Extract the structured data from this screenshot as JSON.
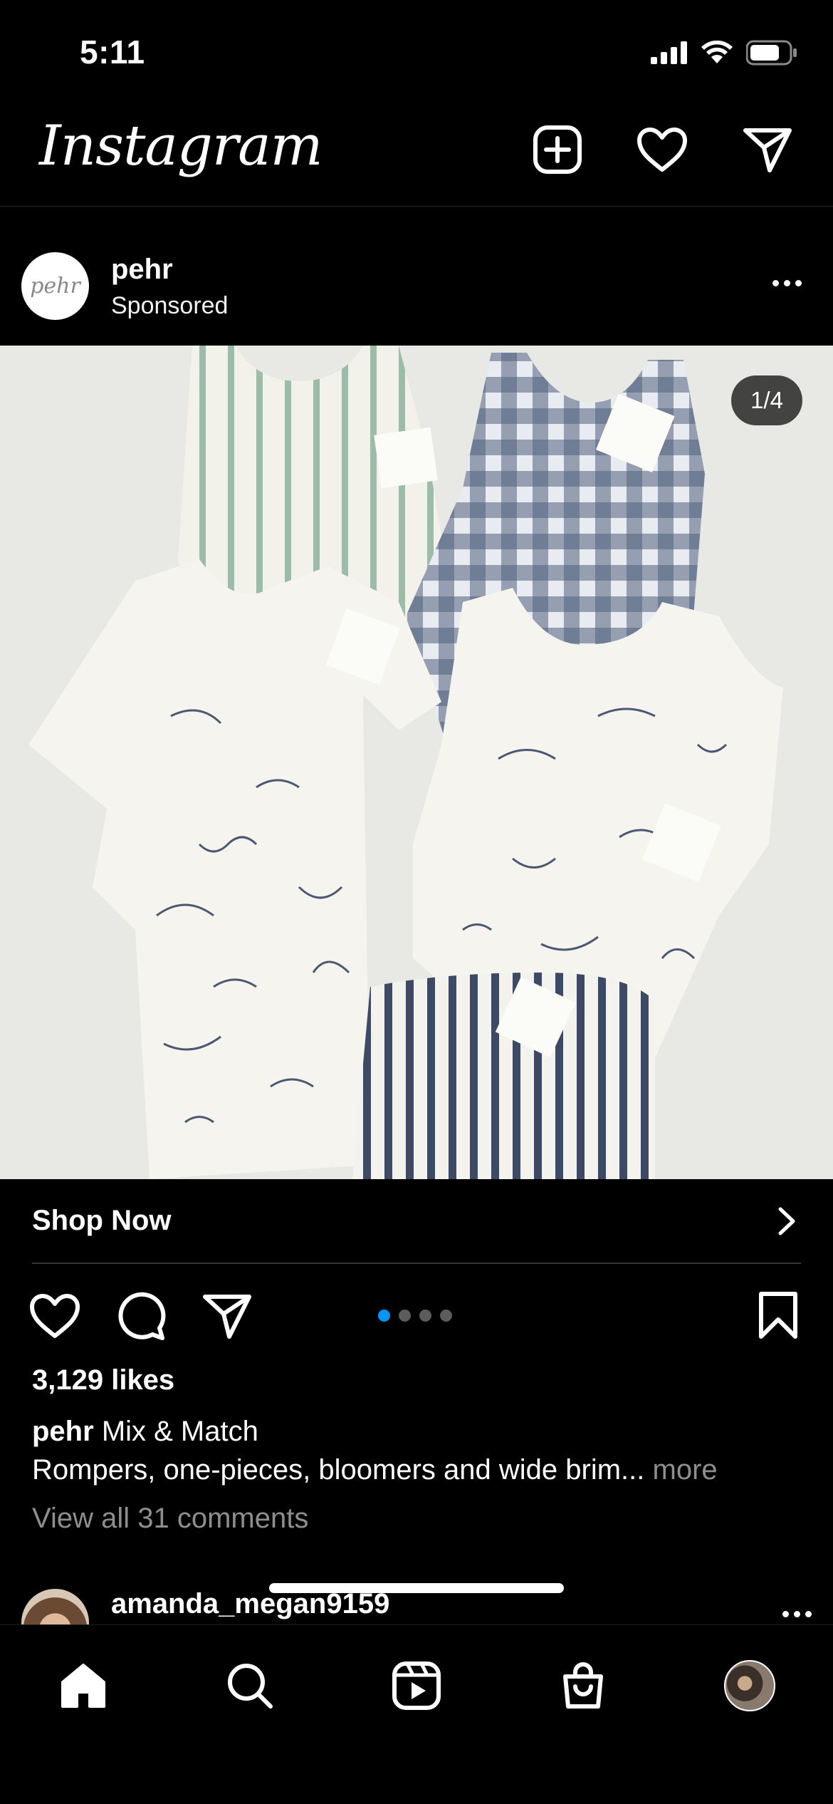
{
  "status_bar": {
    "time": "5:11"
  },
  "header": {
    "logo": "Instagram"
  },
  "post": {
    "username": "pehr",
    "sponsored_label": "Sponsored",
    "avatar_text": "pehr",
    "image_counter": "1/4",
    "shop_label": "Shop Now",
    "carousel": {
      "total": 4,
      "active_index": 0
    },
    "likes": "3,129 likes",
    "caption_user": "pehr",
    "caption_title": "Mix & Match",
    "caption_text": "Rompers, one-pieces, bloomers and wide brim...",
    "caption_more": "more",
    "view_comments": "View all 31 comments"
  },
  "next_post": {
    "username": "amanda_megan9159"
  },
  "colors": {
    "accent": "#0095f6",
    "background": "#000000",
    "muted": "#8e8e8e"
  },
  "icons": {
    "header": [
      "new-post-icon",
      "heart-icon",
      "direct-message-icon"
    ],
    "actions": [
      "like-icon",
      "comment-icon",
      "share-icon",
      "bookmark-icon"
    ],
    "tabs": [
      "home-icon",
      "search-icon",
      "reels-icon",
      "shop-icon",
      "profile-avatar"
    ]
  }
}
